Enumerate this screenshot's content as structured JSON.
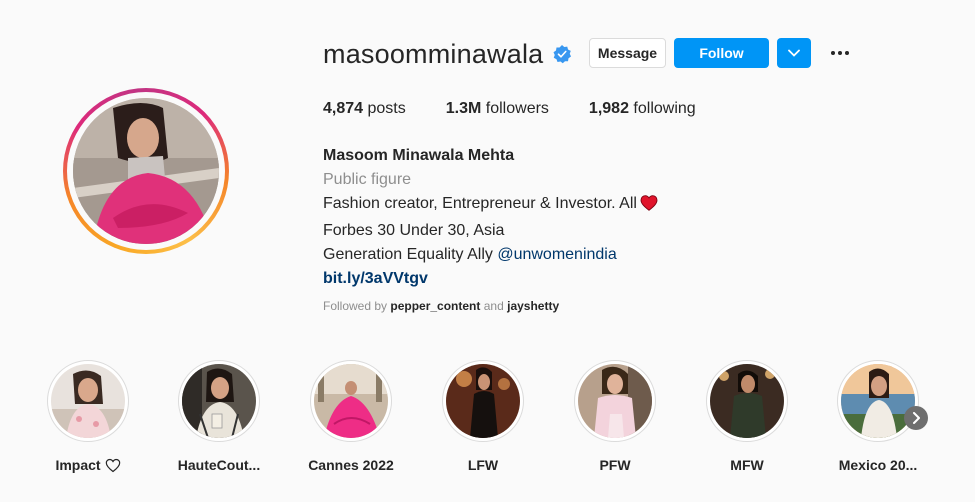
{
  "profile": {
    "username": "masoomminawala",
    "verified_icon": "verified-badge-icon",
    "buttons": {
      "message": "Message",
      "follow": "Follow"
    },
    "stats": {
      "posts_value": "4,874",
      "posts_label": "posts",
      "followers_value": "1.3M",
      "followers_label": "followers",
      "following_value": "1,982",
      "following_label": "following"
    },
    "bio": {
      "full_name": "Masoom Minawala Mehta",
      "category": "Public figure",
      "line1": "Fashion creator, Entrepreneur & Investor. All",
      "line2": "Forbes 30 Under 30, Asia",
      "line3_text": "Generation Equality Ally",
      "line3_mention": "@unwomenindia",
      "link": "bit.ly/3aVVtgv"
    },
    "followed_by": {
      "prefix": "Followed by",
      "user1": "pepper_content",
      "conjunction": "and",
      "user2": "jayshetty"
    }
  },
  "highlights": [
    {
      "label": "Impact",
      "icon": "heart-outline-icon"
    },
    {
      "label": "HauteCout..."
    },
    {
      "label": "Cannes 2022"
    },
    {
      "label": "LFW"
    },
    {
      "label": "PFW"
    },
    {
      "label": "MFW"
    },
    {
      "label": "Mexico 20..."
    }
  ],
  "colors": {
    "accent": "#0095f6",
    "link": "#00376b",
    "muted": "#8e8e8e",
    "heart": "#ed4956"
  }
}
